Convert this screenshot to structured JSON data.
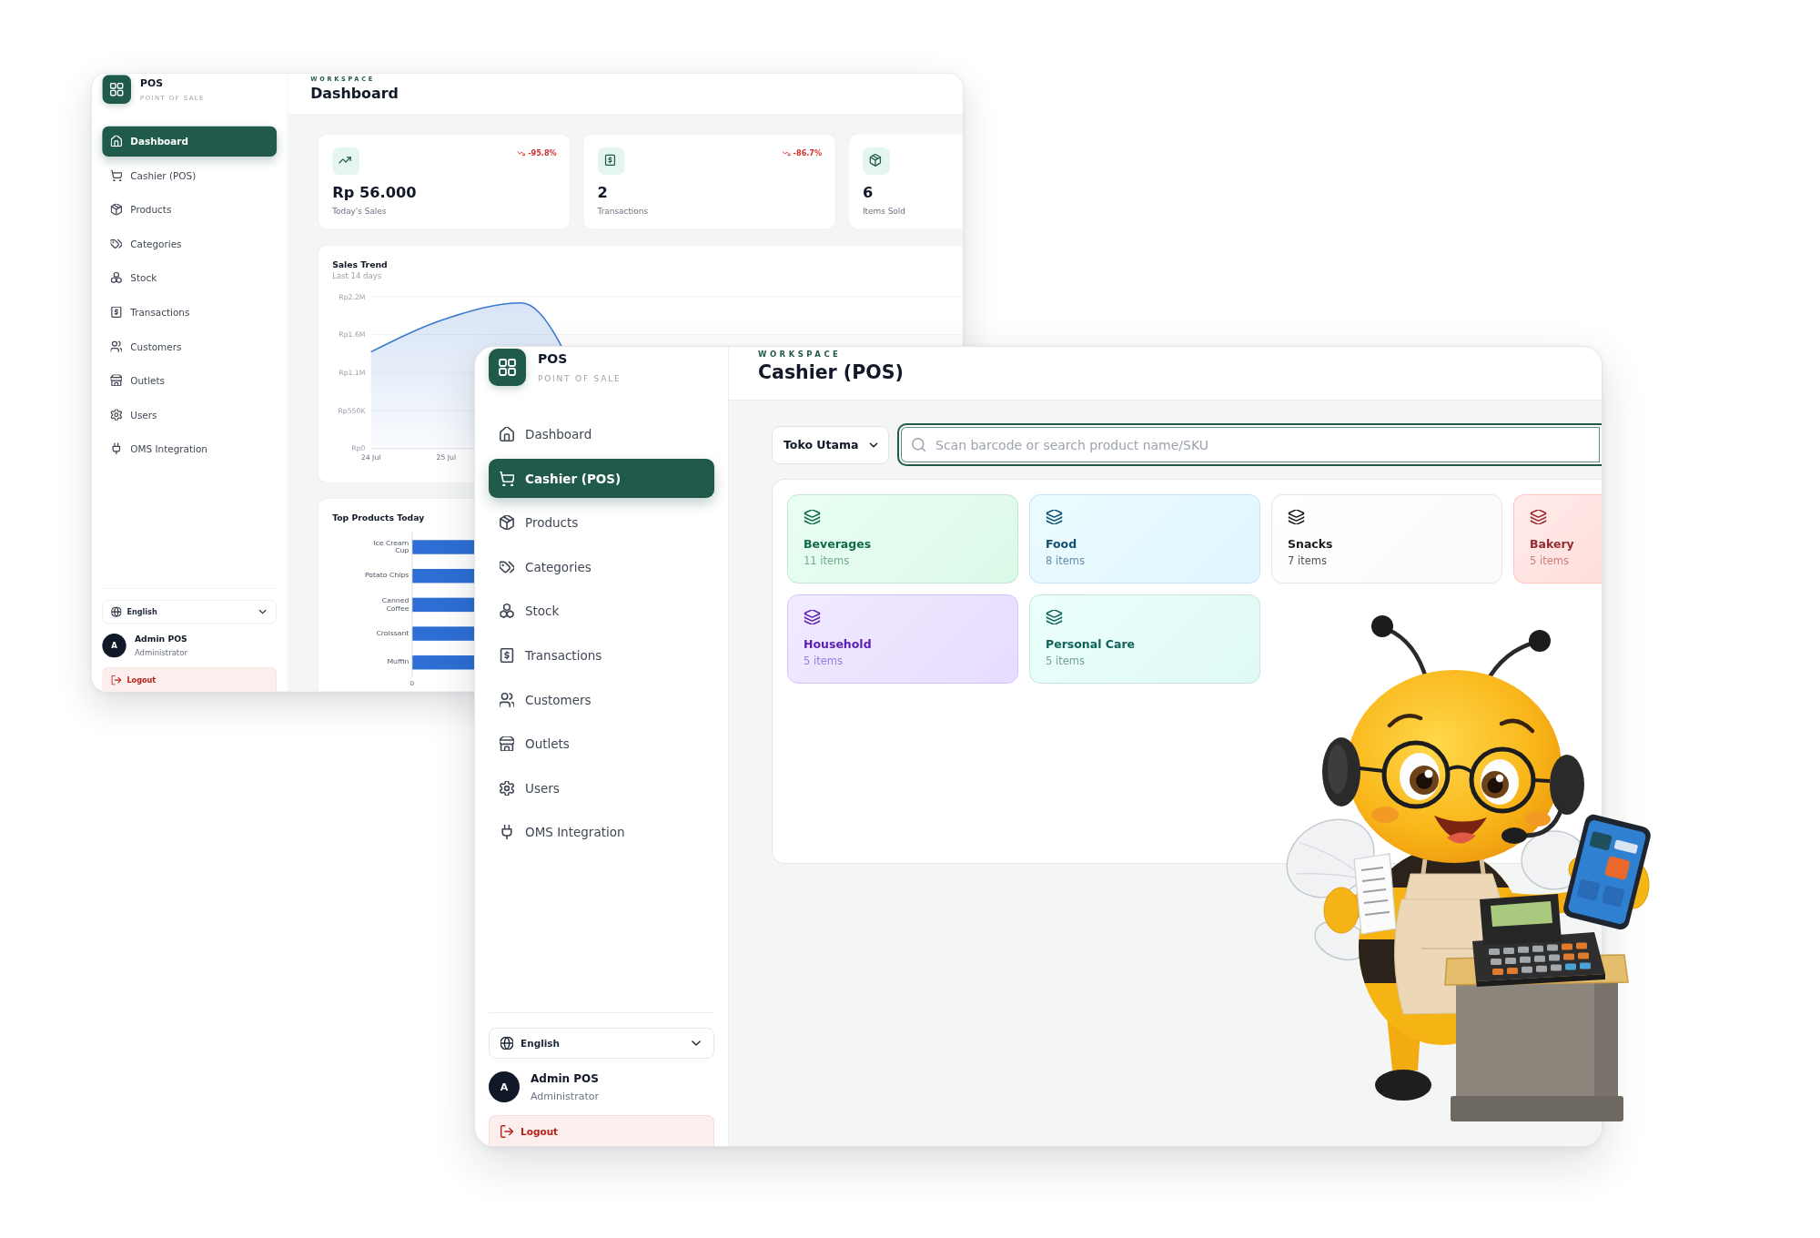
{
  "dashboard_window": {
    "sidebar": {
      "app_name": "POS",
      "tagline": "POINT OF SALE",
      "items": [
        {
          "label": "Dashboard",
          "selected": true
        },
        {
          "label": "Cashier (POS)",
          "selected": false
        },
        {
          "label": "Products",
          "selected": false
        },
        {
          "label": "Categories",
          "selected": false
        },
        {
          "label": "Stock",
          "selected": false
        },
        {
          "label": "Transactions",
          "selected": false
        },
        {
          "label": "Customers",
          "selected": false
        },
        {
          "label": "Outlets",
          "selected": false
        },
        {
          "label": "Users",
          "selected": false
        },
        {
          "label": "OMS Integration",
          "selected": false
        }
      ],
      "language": "English",
      "user": {
        "initial": "A",
        "name": "Admin POS",
        "role": "Administrator"
      },
      "logout": "Logout"
    },
    "header": {
      "eyebrow": "WORKSPACE",
      "title": "Dashboard"
    },
    "stats": [
      {
        "value": "Rp 56.000",
        "label": "Today's Sales",
        "change": "-95.8%",
        "negative": true
      },
      {
        "value": "2",
        "label": "Transactions",
        "change": "-86.7%",
        "negative": true
      },
      {
        "value": "6",
        "label": "Items Sold"
      }
    ],
    "sales_trend": {
      "title": "Sales Trend",
      "subtitle": "Last 14 days",
      "y_labels": [
        "Rp2.2M",
        "Rp1.6M",
        "Rp1.1M",
        "Rp550K",
        "Rp0"
      ],
      "x_labels": [
        "24 Jul",
        "25 Jul"
      ]
    },
    "top_products": {
      "title": "Top Products Today",
      "labels": [
        "Ice Cream Cup",
        "Potato Chips",
        "Canned Coffee",
        "Croissant",
        "Muffin"
      ],
      "x_tick": "0"
    }
  },
  "cashier_window": {
    "sidebar": {
      "app_name": "POS",
      "tagline": "POINT OF SALE",
      "items": [
        {
          "label": "Dashboard",
          "selected": false
        },
        {
          "label": "Cashier (POS)",
          "selected": true
        },
        {
          "label": "Products",
          "selected": false
        },
        {
          "label": "Categories",
          "selected": false
        },
        {
          "label": "Stock",
          "selected": false
        },
        {
          "label": "Transactions",
          "selected": false
        },
        {
          "label": "Customers",
          "selected": false
        },
        {
          "label": "Outlets",
          "selected": false
        },
        {
          "label": "Users",
          "selected": false
        },
        {
          "label": "OMS Integration",
          "selected": false
        }
      ],
      "language": "English",
      "user": {
        "initial": "A",
        "name": "Admin POS",
        "role": "Administrator"
      },
      "logout": "Logout"
    },
    "header": {
      "eyebrow": "WORKSPACE",
      "title": "Cashier (POS)"
    },
    "outlet_select": {
      "value": "Toko Utama"
    },
    "search": {
      "placeholder": "Scan barcode or search product name/SKU"
    },
    "categories": [
      {
        "name": "Beverages",
        "count": "11 items",
        "color": "#0f6b47"
      },
      {
        "name": "Food",
        "count": "8 items",
        "color": "#0f4f73"
      },
      {
        "name": "Snacks",
        "count": "7 items",
        "color": "#1c1c1c"
      },
      {
        "name": "Bakery",
        "count": "5 items",
        "color": "#962a30"
      },
      {
        "name": "Household",
        "count": "5 items",
        "color": "#5b21b6"
      },
      {
        "name": "Personal Care",
        "count": "5 items",
        "color": "#10635a"
      }
    ]
  }
}
